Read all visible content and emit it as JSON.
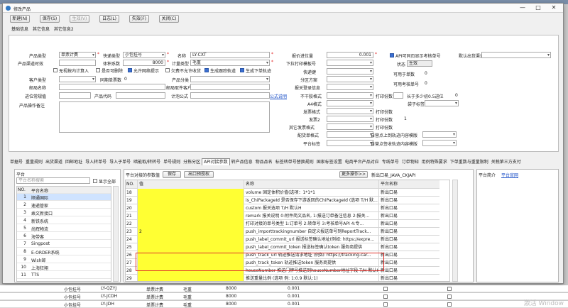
{
  "window": {
    "title": "修改产品"
  },
  "toolbar": {
    "buttons": [
      "新建(N)",
      "保存(S)",
      "生效(V)",
      "日志(L)",
      "失效(F)",
      "关闭(C)"
    ]
  },
  "top_tabs": [
    "基础信息",
    "其它信息",
    "其它信息2"
  ],
  "form": {
    "product_type_label": "产品类型",
    "product_type": "单票计费",
    "express_type_label": "快递类型",
    "express_type": "小包挂号",
    "name_label": "名称",
    "name": "LY-CXT",
    "product_wt_label": "产品渠道时效",
    "volume_coef_label": "体积系数",
    "volume_coef": "8000",
    "calc_type_label": "计量类型",
    "calc_type": "毛重",
    "cb_hidden_label": "无视按内计算入",
    "cb_oversize_label": "是否可删除",
    "cb_allow_label": "允许网络提示",
    "cb_owe_label": "欠费不允许收货",
    "cb_track_label": "生成跟踪轨道",
    "cb_order_label": "生成下单轨迹",
    "cust_type_label": "客户类型",
    "sync_count_label": "同期单票数",
    "sync_count": "0",
    "prod_class_label": "产品分类",
    "mail_name_label": "邮局名称",
    "mail_target_label": "邮局取件客户",
    "entry_port_label": "进位常规值",
    "product_code_label": "产品代码",
    "calc_formula_label": "计泡公式",
    "remark_label": "产品操作备注",
    "shenbao_label": "报价进位量",
    "shenbao": "0.001",
    "down_print_label": "下拉打印模板号",
    "express_type2_label": "快递键",
    "branch_label": "分区方案",
    "report_code_label": "报关登录信息",
    "formula_link": "公式说明",
    "no_weight_label": "不干胶格式",
    "a4_label": "A4格式",
    "invoice_label": "发票格式",
    "invoice2_label": "发票2",
    "other_label": "其它发票格式",
    "delivery_label": "配货单格式",
    "platform_label": "平台标签",
    "print_count_label": "打印份数",
    "print_count": "1",
    "greater_label": "长于多少初0.5进位",
    "greater": "0",
    "bag_label": "袋子标签",
    "print_count2_label": "打印份数",
    "print_count3_label": "打印份数",
    "print_count4_label": "打印份数",
    "print_count4": "1",
    "self_label1": "自营点上到轨迹内容模版",
    "self_label2": "自营点签收轨迹内容模版",
    "api_cb_label": "API可同页显示考核单号",
    "default_send_label": "默认出货渠道",
    "status_label": "状态",
    "status": "生效",
    "usable_count_label": "可用于单数",
    "usable_count": "0",
    "usable_tracking_label": "可用考核单号",
    "usable_tracking": "0"
  },
  "sub_tabs": [
    "单据号",
    "重量规则",
    "出货渠道",
    "回邮地址",
    "导入转单号",
    "导入子单号",
    "暗能取/转转号",
    "单号规则",
    "分拣分区",
    "API对接参数",
    "转产品信息",
    "物品品名",
    "标签转单号替换规则",
    "国家标签设置",
    "电商平台产品对应",
    "专线单号",
    "订单物知",
    "用例特殊要求",
    "下单重数与重量限制",
    "关税第三方支付"
  ],
  "platform_pane": {
    "title": "平台",
    "search_placeholder": "平台名称搜索",
    "show_all_label": "显示全部",
    "col_no": "NO.",
    "col_name": "平台名称",
    "rows": [
      {
        "no": "1",
        "name": "顺通国际"
      },
      {
        "no": "2",
        "name": "速递管家"
      },
      {
        "no": "3",
        "name": "乘文新接口"
      },
      {
        "no": "4",
        "name": "新铁系统"
      },
      {
        "no": "5",
        "name": "尚辉物流"
      },
      {
        "no": "6",
        "name": "海带客"
      },
      {
        "no": "7",
        "name": "Singpost"
      },
      {
        "no": "8",
        "name": "E-ORDER系统"
      },
      {
        "no": "9",
        "name": "Wish邮"
      },
      {
        "no": "10",
        "name": "上海狂翔"
      },
      {
        "no": "11",
        "name": "TTS"
      }
    ]
  },
  "params_pane": {
    "title": "平台对接的参数值",
    "save_label": "保存",
    "export_label": "出口预授权",
    "more_label": "更多操作>>",
    "api_label": "新出口易_JAVA_CKJAPI",
    "col_no": "NO.",
    "col_val": "值",
    "col_name": "名称",
    "col_platform": "平台名称",
    "rows": [
      {
        "no": "18",
        "val": "",
        "name": "volume 固定体积价值(选项：1*1*1",
        "platform": "新出口易"
      },
      {
        "no": "19",
        "val": "",
        "name": "is_ChiPackageId 是否保存下游返回的ChiPackageId (选项 T/H 默...",
        "platform": "新出口易"
      },
      {
        "no": "20",
        "val": "",
        "name": "custom 报关选项 T/H 默认H",
        "platform": "新出口易"
      },
      {
        "no": "21",
        "val": "",
        "name": "remark 报关说明 0:附件简文品名, 1:报送订单备注信息 2:报关...",
        "platform": "新出口易"
      },
      {
        "no": "22",
        "val": "",
        "name": "打印对接的单号类型  1:订单号 2:转单号 3:考核单号API 4:专...",
        "platform": "新出口易"
      },
      {
        "no": "23",
        "val": "2",
        "name": "push_importtrackingnumber 自定义报送单号到ReportTrack...",
        "platform": "新出口易"
      },
      {
        "no": "24",
        "val": "",
        "name": "push_label_commit_url 报送标签确认地址(例如: https://expre...",
        "platform": "新出口易"
      },
      {
        "no": "25",
        "val": "",
        "name": "push_label_commit_token 报送标签确认token 服务商提供",
        "platform": "新出口易"
      },
      {
        "no": "26",
        "val": "",
        "name": "push_track_url 轨迹推送请求地址  (例如: https://tracking-car...",
        "platform": "新出口易"
      },
      {
        "no": "27",
        "val": "",
        "name": "push_track_token 轨迹推送token 服务商提供",
        "platform": "新出口易"
      },
      {
        "no": "28",
        "val": "",
        "name": "houseNumber 推送门牌号推送到houseNumber地址字段 T/H 默认H",
        "platform": "新出口易"
      },
      {
        "no": "29",
        "val": "",
        "name": "推送重量比例 (选项 例: 1:0.9 默认:1)",
        "platform": "新出口易"
      }
    ]
  },
  "right_pane": {
    "title": "平台简介",
    "link": "平台官网"
  },
  "bg_rows": [
    {
      "type": "小包挂号",
      "code": "LY-QZYJ",
      "bill": "单票计费",
      "wt": "毛重",
      "vol": "8000",
      "v2": "0.001"
    },
    {
      "type": "小包挂号",
      "code": "LY-JCDH",
      "bill": "单票计费",
      "wt": "毛重",
      "vol": "8000",
      "v2": "0.001"
    },
    {
      "type": "小包挂号",
      "code": "LY-JDH",
      "bill": "单票计费",
      "wt": "毛重",
      "vol": "8000",
      "v2": "0.001"
    }
  ],
  "watermark": "激活 Window"
}
